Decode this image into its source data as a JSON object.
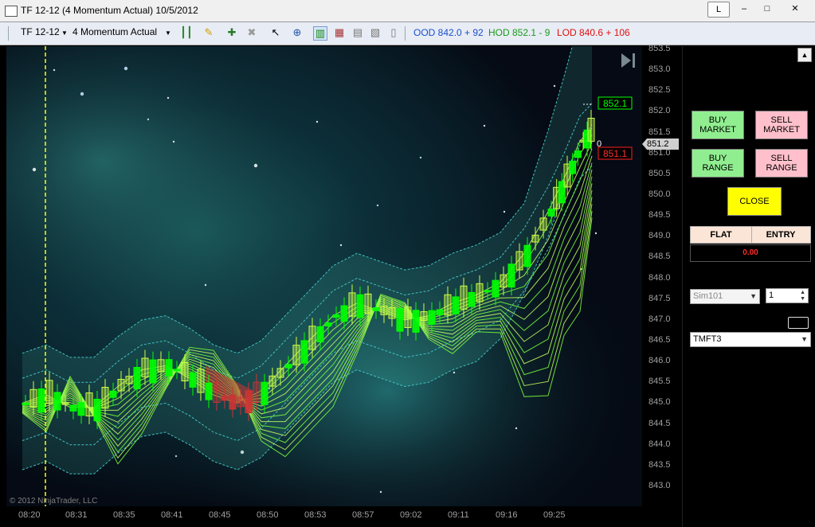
{
  "window": {
    "title": "TF 12-12 (4 Momentum Actual)  10/5/2012",
    "buttons": {
      "link": "L",
      "minimize": "–",
      "maximize": "□",
      "close": "✕"
    }
  },
  "toolbar": {
    "instrument": "TF 12-12",
    "template": "4 Momentum Actual",
    "ood": "OOD  842.0 + 92",
    "hod": "HOD  852.1 - 9",
    "lod": "LOD  840.6 + 106"
  },
  "chart_data": {
    "type": "candlestick",
    "ylim": [
      842.7,
      853.6
    ],
    "price_ticks": [
      "853.5",
      "853.0",
      "852.5",
      "852.0",
      "851.5",
      "851.0",
      "850.5",
      "850.0",
      "849.5",
      "849.0",
      "848.5",
      "848.0",
      "847.5",
      "847.0",
      "846.5",
      "846.0",
      "845.5",
      "845.0",
      "844.5",
      "844.0",
      "843.5",
      "843.0"
    ],
    "time_ticks": [
      "08:20",
      "08:31",
      "08:35",
      "08:41",
      "08:45",
      "08:50",
      "08:53",
      "08:57",
      "09:02",
      "09:11",
      "09:16",
      "09:25"
    ],
    "last_price_label": "851.2",
    "high_marker": "852.1",
    "low_marker": "851.1",
    "zero_marker": "0",
    "copyright": "© 2012 NinjaTrader, LLC",
    "colors": {
      "up": "#00ff00",
      "down_in_uptrend": "#ccff44",
      "bear": "#cc3333",
      "band": "#40c0c0",
      "vline": "#ffff00"
    }
  },
  "panel": {
    "buy_market": "BUY\nMARKET",
    "sell_market": "SELL\nMARKET",
    "buy_range": "BUY\nRANGE",
    "sell_range": "SELL\nRANGE",
    "close": "CLOSE",
    "flat": "FLAT",
    "entry": "ENTRY",
    "pnl": "0.00",
    "account": "Sim101",
    "quantity": "1",
    "atm": "TMFT3"
  }
}
